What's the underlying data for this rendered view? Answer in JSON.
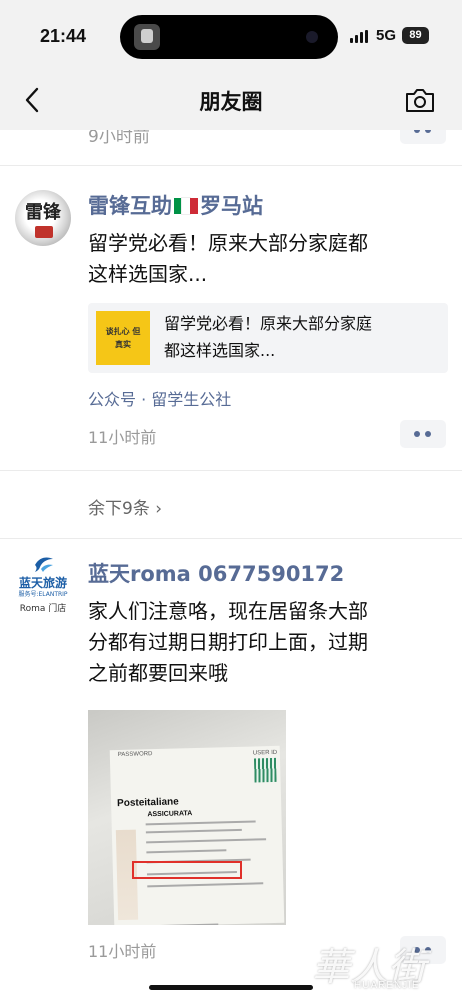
{
  "status_bar": {
    "time": "21:44",
    "network": "5G",
    "battery": "89"
  },
  "nav": {
    "title": "朋友圈"
  },
  "previous_post": {
    "time": "9小时前"
  },
  "posts": [
    {
      "author_prefix": "雷锋互助",
      "author_suffix": "罗马站",
      "flag": {
        "colors": [
          "#009246",
          "#ffffff",
          "#ce2b37"
        ]
      },
      "avatar_text": "雷锋",
      "text_lines": [
        "留学党必看！原来大部分家庭都",
        "这样选国家..."
      ],
      "link": {
        "thumb_text": "谈扎心 但真实",
        "title_lines": [
          "留学党必看！原来大部分家庭",
          "都这样选国家..."
        ]
      },
      "source": "公众号 · 留学生公社",
      "time": "11小时前"
    },
    {
      "author": "蓝天roma   0677590172",
      "avatar": {
        "name": "蓝天旅游",
        "sub": "服务号:ELANTRIP",
        "store": "Roma 门店"
      },
      "text_lines": [
        "家人们注意咯，现在居留条大部",
        "分都有过期日期打印上面，过期",
        "之前都要回来哦"
      ],
      "photo": {
        "header_left": "PASSWORD",
        "header_right": "USER ID",
        "brand": "Posteitaliane",
        "section": "ASSICURATA"
      },
      "time": "11小时前"
    }
  ],
  "remaining": "余下9条",
  "watermark": {
    "text": "華人街",
    "sub": "HUARENJIE"
  }
}
